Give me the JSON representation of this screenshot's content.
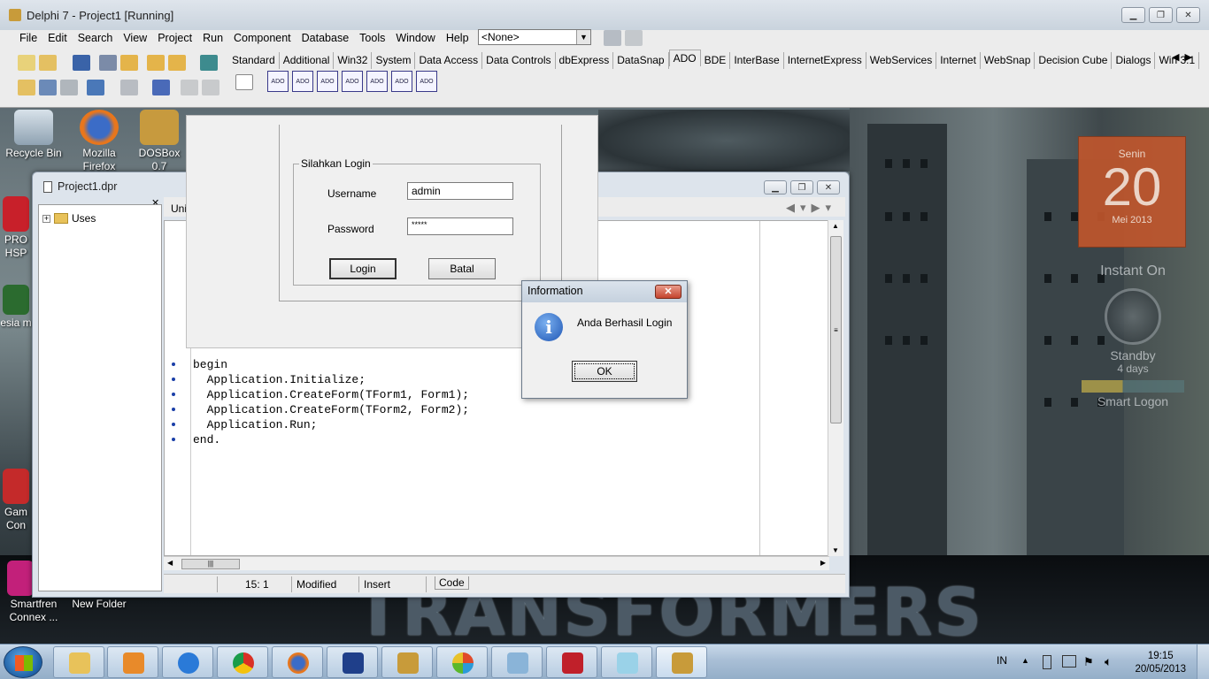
{
  "ide": {
    "title": "Delphi 7 - Project1 [Running]",
    "menu": [
      "File",
      "Edit",
      "Search",
      "View",
      "Project",
      "Run",
      "Component",
      "Database",
      "Tools",
      "Window",
      "Help"
    ],
    "component_combo": "<None>",
    "palette_tabs": [
      "Standard",
      "Additional",
      "Win32",
      "System",
      "Data Access",
      "Data Controls",
      "dbExpress",
      "DataSnap",
      "ADO",
      "BDE",
      "InterBase",
      "InternetExpress",
      "WebServices",
      "Internet",
      "WebSnap",
      "Decision Cube",
      "Dialogs",
      "Win 3.1"
    ],
    "active_palette_tab": "ADO",
    "ado_components": [
      "ADO",
      "ADO",
      "ADO",
      "ADO",
      "ADO",
      "ADO",
      "ADO",
      "ADO"
    ]
  },
  "desktop": {
    "icons": [
      {
        "label": "Recycle Bin",
        "icon": "recycle-bin-icon"
      },
      {
        "label": "Mozilla Firefox",
        "icon": "firefox-icon"
      },
      {
        "label": "DOSBox 0.7",
        "icon": "dosbox-icon"
      },
      {
        "label": "PRO HSP",
        "icon": "app-icon"
      },
      {
        "label": "esia m",
        "icon": "app-icon"
      },
      {
        "label": "Gam Con",
        "icon": "app-icon"
      },
      {
        "label": "Smartfren Connex ...",
        "icon": "smartfren-icon"
      },
      {
        "label": "New Folder",
        "icon": "folder-icon"
      }
    ],
    "calendar_gadget": {
      "day_name": "Senin",
      "day_num": "20",
      "month": "Mei 2013"
    },
    "instant_gadget": {
      "title": "Instant On",
      "standby": "Standby",
      "days": "4 days",
      "smart_logon": "Smart Logon"
    },
    "wallpaper_text": "TRANSFORMERS"
  },
  "project_window": {
    "title": "Project1.dpr",
    "tree_item": "Uses",
    "editor_tab": "Uni",
    "code_lines": [
      "begin",
      "  Application.Initialize;",
      "  Application.CreateForm(TForm1, Form1);",
      "  Application.CreateForm(TForm2, Form2);",
      "  Application.Run;",
      "end."
    ],
    "status": {
      "position": "15:  1",
      "modified": "Modified",
      "mode": "Insert",
      "tab": "Code"
    }
  },
  "login_form": {
    "group_caption": "Silahkan Login",
    "username_label": "Username",
    "username_value": "admin",
    "password_label": "Password",
    "password_value": "*****",
    "login_button": "Login",
    "cancel_button": "Batal"
  },
  "info_dialog": {
    "title": "Information",
    "message": "Anda Berhasil Login",
    "ok_button": "OK"
  },
  "taskbar": {
    "apps": [
      "explorer",
      "media-player",
      "internet-explorer",
      "chrome",
      "firefox",
      "dev-cpp",
      "delphi-7",
      "app",
      "paint",
      "acrobat",
      "notepad",
      "delphi-7-active"
    ],
    "language": "IN",
    "time": "19:15",
    "date": "20/05/2013"
  },
  "colors": {
    "calendar_bg": "#c2562c",
    "taskbar_bg": "#a9bfd6",
    "dialog_close": "#c4442e"
  }
}
